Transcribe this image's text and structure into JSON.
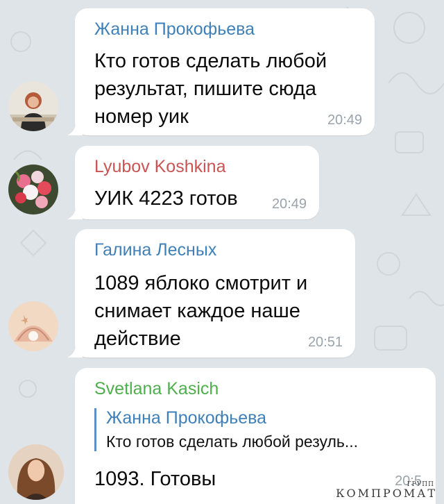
{
  "chat": {
    "messages": [
      {
        "sender": "Жанна Прокофьева",
        "sender_color": "#3f80b8",
        "text": "Кто готов сделать любой\nрезультат, пишите сюда\nномер уик",
        "time": "20:49",
        "avatar": "woman-at-desk-avatar"
      },
      {
        "sender": "Lyubov Koshkina",
        "sender_color": "#c95454",
        "text": "УИК 4223 готов",
        "time": "20:49",
        "avatar": "flowers-avatar"
      },
      {
        "sender": "Галина Лесных",
        "sender_color": "#3f80b8",
        "text": "1089 яблоко смотрит и\nснимает каждое наше\nдействие",
        "time": "20:51",
        "avatar": "seashell-avatar"
      },
      {
        "sender": "Svetlana Kasich",
        "sender_color": "#4fae4e",
        "reply_to": {
          "name": "Жанна Прокофьева",
          "text": "Кто готов сделать любой резуль..."
        },
        "text": "1093. Готовы",
        "time": "20:5",
        "avatar": "woman-long-hair-avatar"
      }
    ]
  },
  "watermark": {
    "top": "ГРУПП",
    "main": "КОМПРОМАТ"
  }
}
